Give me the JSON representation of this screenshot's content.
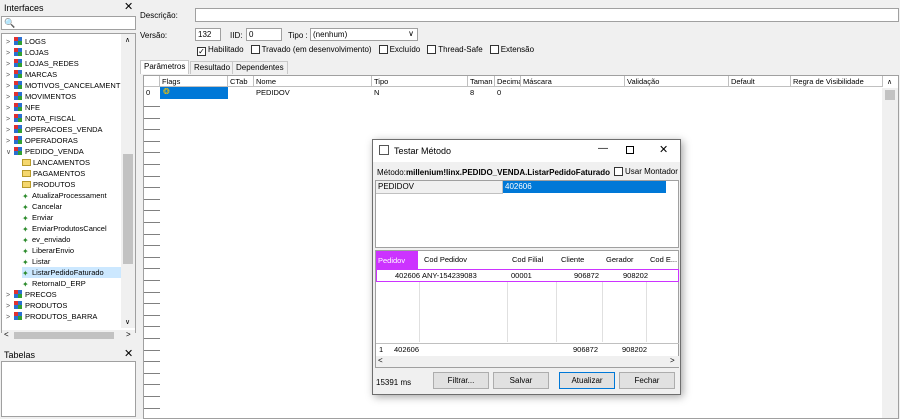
{
  "left_panel": {
    "title": "Interfaces",
    "search_value": "",
    "tree": [
      {
        "label": "LOGS",
        "level": 0,
        "kind": "db",
        "expanded": false,
        "selected": false
      },
      {
        "label": "LOJAS",
        "level": 0,
        "kind": "db",
        "expanded": false,
        "selected": false
      },
      {
        "label": "LOJAS_REDES",
        "level": 0,
        "kind": "db",
        "expanded": false,
        "selected": false
      },
      {
        "label": "MARCAS",
        "level": 0,
        "kind": "db",
        "expanded": false,
        "selected": false
      },
      {
        "label": "MOTIVOS_CANCELAMENT",
        "level": 0,
        "kind": "db",
        "expanded": false,
        "selected": false
      },
      {
        "label": "MOVIMENTOS",
        "level": 0,
        "kind": "db",
        "expanded": false,
        "selected": false
      },
      {
        "label": "NFE",
        "level": 0,
        "kind": "db",
        "expanded": false,
        "selected": false
      },
      {
        "label": "NOTA_FISCAL",
        "level": 0,
        "kind": "db",
        "expanded": false,
        "selected": false
      },
      {
        "label": "OPERACOES_VENDA",
        "level": 0,
        "kind": "db",
        "expanded": false,
        "selected": false
      },
      {
        "label": "OPERADORAS",
        "level": 0,
        "kind": "db",
        "expanded": false,
        "selected": false
      },
      {
        "label": "PEDIDO_VENDA",
        "level": 0,
        "kind": "db",
        "expanded": true,
        "selected": false
      },
      {
        "label": "LANCAMENTOS",
        "level": 1,
        "kind": "folder",
        "selected": false
      },
      {
        "label": "PAGAMENTOS",
        "level": 1,
        "kind": "folder",
        "selected": false
      },
      {
        "label": "PRODUTOS",
        "level": 1,
        "kind": "folder",
        "selected": false
      },
      {
        "label": "AtualizaProcessament",
        "level": 1,
        "kind": "method",
        "selected": false
      },
      {
        "label": "Cancelar",
        "level": 1,
        "kind": "method",
        "selected": false
      },
      {
        "label": "Enviar",
        "level": 1,
        "kind": "method",
        "selected": false
      },
      {
        "label": "EnviarProdutosCancel",
        "level": 1,
        "kind": "method",
        "selected": false
      },
      {
        "label": "ev_enviado",
        "level": 1,
        "kind": "method",
        "selected": false
      },
      {
        "label": "LiberarEnvio",
        "level": 1,
        "kind": "method",
        "selected": false
      },
      {
        "label": "Listar",
        "level": 1,
        "kind": "method",
        "selected": false
      },
      {
        "label": "ListarPedidoFaturado",
        "level": 1,
        "kind": "method",
        "selected": true
      },
      {
        "label": "RetornaID_ERP",
        "level": 1,
        "kind": "method",
        "selected": false
      },
      {
        "label": "PRECOS",
        "level": 0,
        "kind": "db",
        "expanded": false,
        "selected": false
      },
      {
        "label": "PRODUTOS",
        "level": 0,
        "kind": "db",
        "expanded": false,
        "selected": false
      },
      {
        "label": "PRODUTOS_BARRA",
        "level": 0,
        "kind": "db",
        "expanded": false,
        "selected": false
      }
    ],
    "tables_title": "Tabelas"
  },
  "form": {
    "descricao_label": "Descrição:",
    "descricao_value": "",
    "versao_label": "Versão:",
    "versao_value": "132",
    "iid_label": "IID:",
    "iid_value": "0",
    "tipo_label": "Tipo :",
    "tipo_value": "(nenhum)",
    "checks": [
      {
        "label": "Habilitado",
        "checked": true
      },
      {
        "label": "Travado (em desenvolvimento)",
        "checked": false
      },
      {
        "label": "Excluído",
        "checked": false
      },
      {
        "label": "Thread-Safe",
        "checked": false
      },
      {
        "label": "Extensão",
        "checked": false
      }
    ]
  },
  "tabs": [
    {
      "label": "Parâmetros",
      "active": true
    },
    {
      "label": "Resultado",
      "active": false
    },
    {
      "label": "Dependentes",
      "active": false
    }
  ],
  "grid": {
    "columns": [
      "Flags",
      "CTab",
      "Nome",
      "Tipo",
      "Taman",
      "Decima",
      "Máscara",
      "Validação",
      "Default",
      "Regra de Visibilidade"
    ],
    "row": {
      "index": "0",
      "nome": "PEDIDOV",
      "tipo": "N",
      "tamanho": "8",
      "decimais": "0"
    }
  },
  "dialog": {
    "title": "Testar Método",
    "method_label": "Método:",
    "method_value": "millenium!linx.PEDIDO_VENDA.ListarPedidoFaturado",
    "usar_montador": "Usar Montador",
    "param_name": "PEDIDOV",
    "param_value": "402606",
    "result_columns": [
      "Pedidov",
      "Cod Pedidov",
      "Cod Filial",
      "Cliente",
      "Gerador",
      "Cod E..."
    ],
    "result_row": {
      "pedidov": "402606",
      "cod_pedidov": "ANY-154239083",
      "cod_filial": "00001",
      "cliente": "906872",
      "gerador": "908202"
    },
    "summary_row": {
      "count": "1",
      "pedidov": "402606",
      "cliente": "906872",
      "gerador": "908202"
    },
    "elapsed": "15391 ms",
    "buttons": {
      "filtrar": "Filtrar...",
      "salvar": "Salvar",
      "atualizar": "Atualizar",
      "fechar": "Fechar"
    }
  },
  "colors": {
    "accent": "#0078d7",
    "highlight": "#cc33ff",
    "selection": "#cce8ff"
  }
}
